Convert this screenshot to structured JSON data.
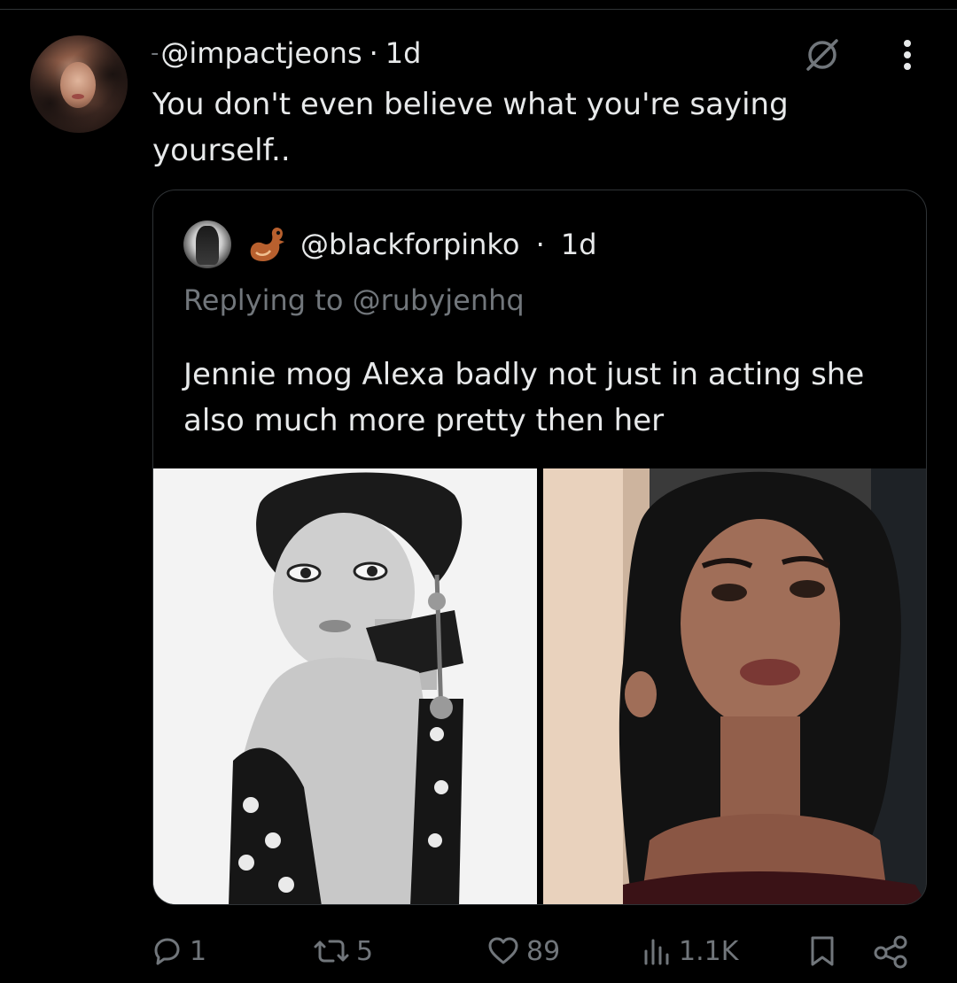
{
  "tweet": {
    "author_dash": "-",
    "handle": "@impactjeons",
    "separator": "·",
    "time": "1d",
    "text": "You don't even believe what you're saying yourself..",
    "icons": {
      "mute": "mute-icon",
      "more": "more-icon"
    }
  },
  "quote": {
    "handle": "@blackforpinko",
    "separator": "·",
    "time": "1d",
    "replying_to": "Replying to @rubyjenhq",
    "text": "Jennie mog Alexa badly not just in acting she also much more pretty then her",
    "media": [
      "photo-black-and-white-portrait",
      "photo-color-portrait"
    ]
  },
  "actions": {
    "replies": "1",
    "reposts": "5",
    "likes": "89",
    "views": "1.1K",
    "icons": [
      "reply-icon",
      "repost-icon",
      "like-icon",
      "views-icon",
      "bookmark-icon",
      "share-icon"
    ]
  },
  "colors": {
    "background": "#000000",
    "primary_text": "#e7e9ea",
    "secondary_text": "#71767b",
    "border": "#2f3336"
  }
}
